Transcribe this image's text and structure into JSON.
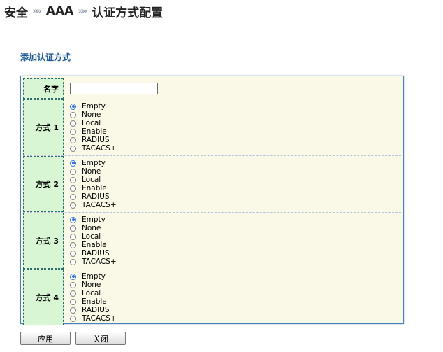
{
  "breadcrumb": {
    "level1": "安全",
    "level2": "AAA",
    "level3": "认证方式配置",
    "separator": "»"
  },
  "section": {
    "title": "添加认证方式"
  },
  "form": {
    "name_label": "名字",
    "name_value": "",
    "methods": [
      {
        "label": "方式 1",
        "selected": "Empty"
      },
      {
        "label": "方式 2",
        "selected": "Empty"
      },
      {
        "label": "方式 3",
        "selected": "Empty"
      },
      {
        "label": "方式 4",
        "selected": "Empty"
      }
    ],
    "options": [
      "Empty",
      "None",
      "Local",
      "Enable",
      "RADIUS",
      "TACACS+"
    ]
  },
  "buttons": {
    "apply": "应用",
    "close": "关闭"
  },
  "colors": {
    "accent": "#1f5b93",
    "label_bg": "#d8f6d3",
    "form_bg": "#faf8e6",
    "radio_checked": "#2b6fd6"
  }
}
